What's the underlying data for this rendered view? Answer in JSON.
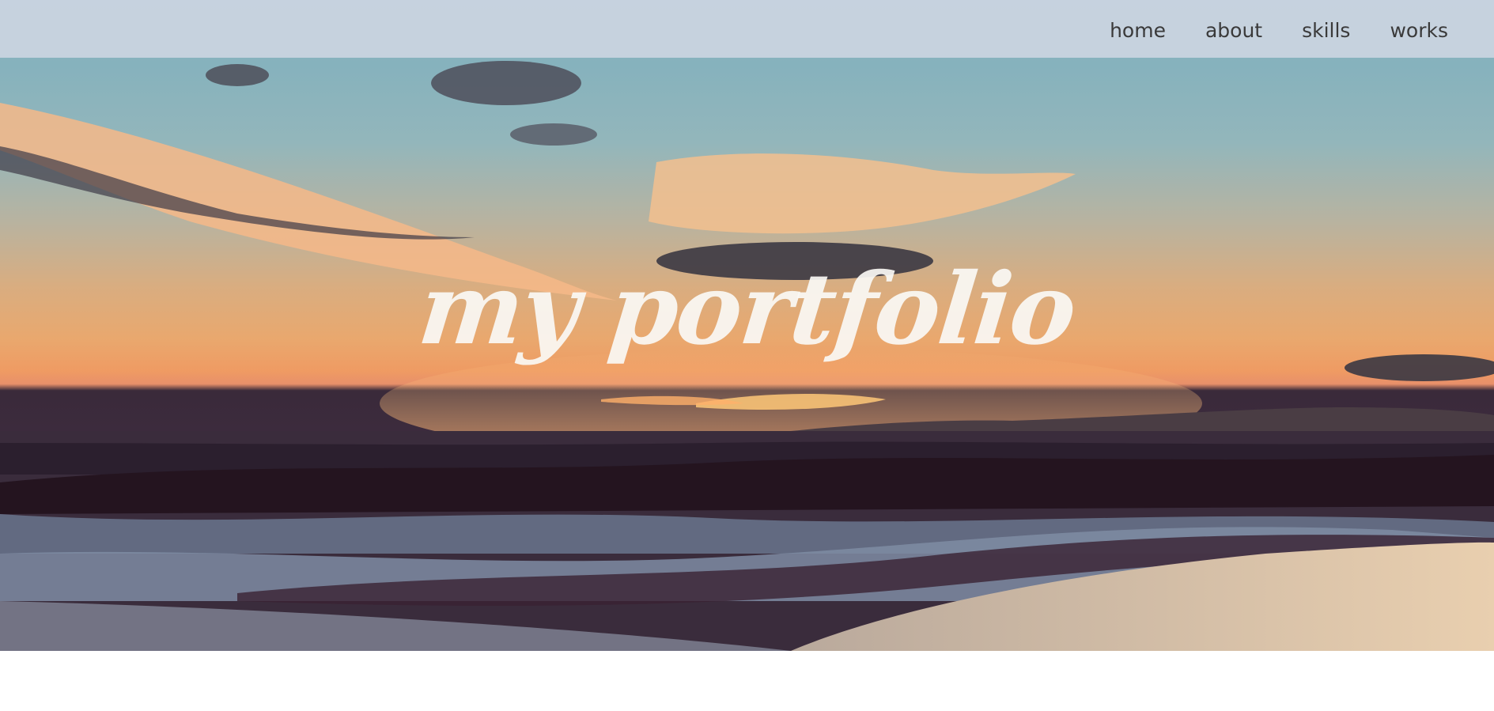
{
  "nav": {
    "items": [
      {
        "label": "home"
      },
      {
        "label": "about"
      },
      {
        "label": "skills"
      },
      {
        "label": "works"
      }
    ]
  },
  "hero": {
    "title": "my portfolio"
  },
  "colors": {
    "navbar_bg": "#ced6e2",
    "nav_text": "#3a3a3a",
    "title_text": "#faf8f5",
    "page_bg": "#ffffff"
  },
  "icons": []
}
